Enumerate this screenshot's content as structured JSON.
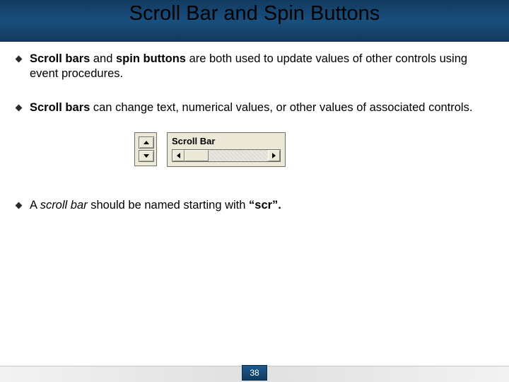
{
  "title": "Scroll Bar and Spin Buttons",
  "bullets": {
    "b1_bold1": "Scroll bars",
    "b1_mid": " and ",
    "b1_bold2": "spin buttons",
    "b1_rest": " are both used to update values of other controls using event procedures.",
    "b2_bold": "Scroll bars",
    "b2_rest": " can change text, numerical values, or other values of associated controls.",
    "b3_pre": "A ",
    "b3_italic": "scroll bar",
    "b3_mid": " should be named starting with ",
    "b3_bold": "“scr”.",
    "b3_post": ""
  },
  "widget": {
    "scroll_label": "Scroll Bar"
  },
  "page_number": "38"
}
